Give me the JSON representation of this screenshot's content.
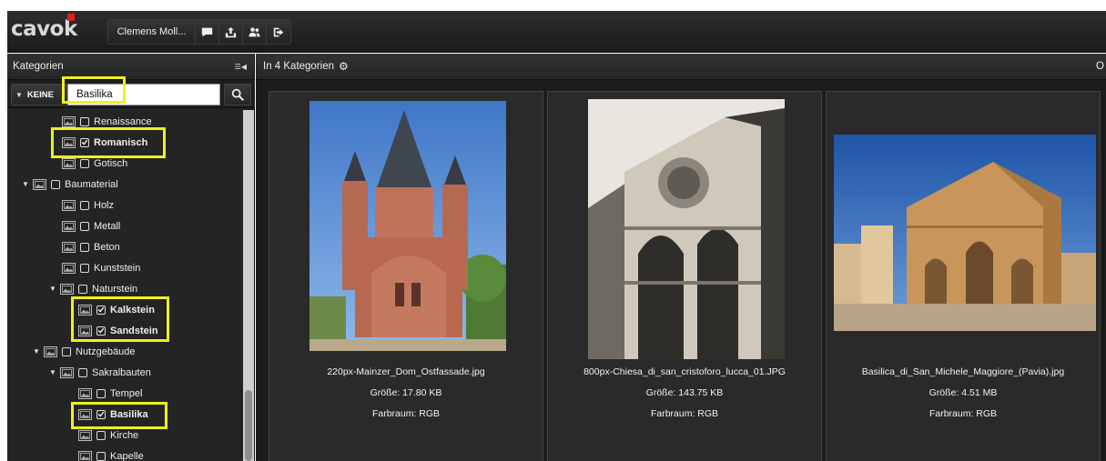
{
  "app": {
    "logo": "cavok"
  },
  "toolbar": {
    "user_label": "Clemens Moll...",
    "icons": [
      "comment-icon",
      "upload-icon",
      "users-icon",
      "logout-icon"
    ]
  },
  "left_panel": {
    "title": "Kategorien",
    "filter_button": "KEINE",
    "search_value": "Basilika",
    "tree": [
      {
        "label": "Renaissance",
        "checked": false
      },
      {
        "label": "Romanisch",
        "checked": true
      },
      {
        "label": "Gotisch",
        "checked": false
      },
      {
        "label": "Baumaterial",
        "checked": false,
        "expanded": true
      },
      {
        "label": "Holz",
        "checked": false
      },
      {
        "label": "Metall",
        "checked": false
      },
      {
        "label": "Beton",
        "checked": false
      },
      {
        "label": "Kunststein",
        "checked": false
      },
      {
        "label": "Naturstein",
        "checked": false,
        "expanded": true
      },
      {
        "label": "Kalkstein",
        "checked": true
      },
      {
        "label": "Sandstein",
        "checked": true
      },
      {
        "label": "Nutzgebäude",
        "checked": false,
        "expanded": true
      },
      {
        "label": "Sakralbauten",
        "checked": false,
        "expanded": true
      },
      {
        "label": "Tempel",
        "checked": false
      },
      {
        "label": "Basilika",
        "checked": true
      },
      {
        "label": "Kirche",
        "checked": false
      },
      {
        "label": "Kapelle",
        "checked": false
      }
    ]
  },
  "right_panel": {
    "title": "In 4 Kategorien",
    "edge_label": "O"
  },
  "results": [
    {
      "filename": "220px-Mainzer_Dom_Ostfassade.jpg",
      "size": "Größe: 17.80 KB",
      "colorspace": "Farbraum: RGB"
    },
    {
      "filename": "800px-Chiesa_di_san_cristoforo_lucca_01.JPG",
      "size": "Größe: 143.75 KB",
      "colorspace": "Farbraum: RGB"
    },
    {
      "filename": "Basilica_di_San_Michele_Maggiore_(Pavia).jpg",
      "size": "Größe: 4.51 MB",
      "colorspace": "Farbraum: RGB"
    }
  ],
  "colors": {
    "highlight": "#f0f01c",
    "topbar": "#222222",
    "panel": "#242424"
  }
}
